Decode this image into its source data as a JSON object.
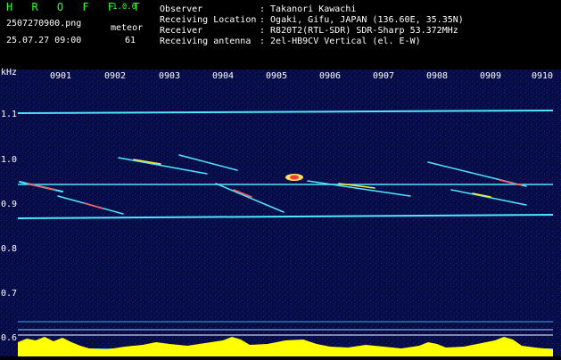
{
  "header": {
    "app_name": "H R O F F T",
    "version": "1.0.0",
    "filename": "2507270900.png",
    "datetime": "25.07.27 09:00",
    "meteor_label": "meteor",
    "meteor_count": "61",
    "fields": [
      {
        "label": "Observer",
        "value": ": Takanori Kawachi"
      },
      {
        "label": "Receiving Location",
        "value": ": Ogaki, Gifu, JAPAN (136.60E, 35.35N)"
      },
      {
        "label": "Receiver",
        "value": ": R820T2(RTL-SDR) SDR-Sharp 53.372MHz"
      },
      {
        "label": "Receiving antenna",
        "value": ": 2el-HB9CV Vertical (el. E-W)"
      }
    ]
  },
  "spectrogram": {
    "freq_unit": "kHz",
    "time_ticks": [
      "0901",
      "0902",
      "0903",
      "0904",
      "0905",
      "0906",
      "0907",
      "0908",
      "0909",
      "0910"
    ],
    "freq_ticks": [
      "1.1",
      "1.0",
      "0.9",
      "0.8",
      "0.7",
      "0.6"
    ],
    "colors": {
      "background": "#070c45",
      "carrier": "#4fe6ff",
      "histogram": "#ffff00",
      "histogram_base": "#30b0ff"
    }
  }
}
